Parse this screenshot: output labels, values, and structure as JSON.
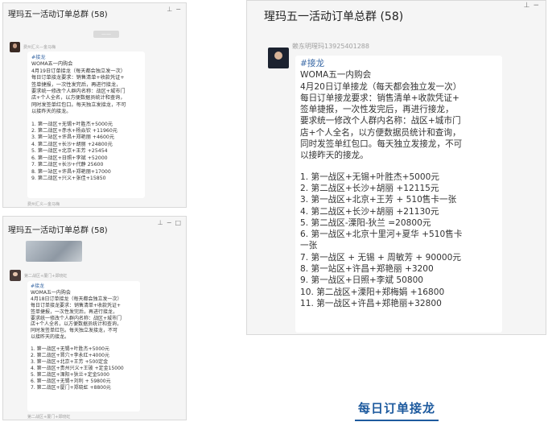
{
  "screens": [
    {
      "title": "瑆玛五一活动订单总群 (58)",
      "top_sender": "费州汇义—金马嗨",
      "timestamp": "——",
      "sender": "费州汇义—金马嗨",
      "tag": "#接龙",
      "lines": [
        "WOMA五一内购会",
        "4月19日订单接龙（每天都会独立发一次）",
        "每日订单接龙要求：销售清单+收款凭证+",
        "签单捷报，一次性发完后，再进行接龙，",
        "要求统一修改个人群内名称：战区+城市门",
        "店+个人全名，以方便数据员统计和查询，",
        "同时发签单红包口。每天独立发接龙，不可",
        "以接昨天的接龙。"
      ],
      "orders": [
        "1. 第一战区+无锡+叶胜杰+5000元",
        "2. 第二战区+赤水+杨焱钦 +11960元",
        "3. 第一站区+许昌+郑艳丽 +4600元",
        "4. 第二战区+长沙+胡丽 +24800元",
        "5. 第一战区+北京+王芳 +25454",
        "6. 第一战区+日照+李斌 +52000",
        "7. 第二战区+长沙+代静 25600",
        "8. 第一站区+许昌+郑艳丽+17000",
        "9. 第二战区+兴义+张佳+15850"
      ],
      "bottom_sender": "费州汇义—金马嗨"
    },
    {
      "title": "瑆玛五一活动订单总群 (58)",
      "sender": "第二战区+厦门+郑晓虹",
      "tag": "#接龙",
      "lines": [
        "WOMA五一内购会",
        "4月18日订单接龙（每天都会独立发一次）",
        "每日订单接龙要求：销售清单+收款凭证+",
        "签单捷报，一次性发完后，再进行接龙，",
        "要求统一修改个人群内名称：战区+城市门",
        "店+个人全名，以方便数据员统计和查询，",
        "同时发签单红包。每天独立发接龙，不可",
        "以接昨天的接龙。"
      ],
      "orders": [
        "1. 第一战区+无锡+叶胜杰+5000元",
        "2. 第二战区+晋穴+李永红+4000元",
        "3. 第一战区+北京+王芳 +500定金",
        "4. 第一战区+贵州兴义+王玻 +定金15000",
        "5. 第二战区+溧阳+狄兰+定金5000",
        "6. 第一战区+无锡+刘利 + 59800元",
        "7. 第二战区+厦门+郑晓虹 +8800元"
      ],
      "bottom_sender": "第二战区+厦门+郑晓虹"
    },
    {
      "title": "瑆玛五一活动订单总群 (58)",
      "sender": "赖东明瑆玛13925401288",
      "tag": "#接龙",
      "lines": [
        "WOMA五一内购会",
        "4月20日订单接龙（每天都会独立发一次）",
        "每日订单接龙要求：销售清单+收款凭证+",
        "签单捷报，一次性发完后，再进行接龙，",
        "要求统一修改个人群内名称：战区+城市门",
        "店+个人全名，以方便数据员统计和查询，",
        "同时发签单红包口。每天独立发接龙，不可",
        "以接昨天的接龙。"
      ],
      "orders": [
        "1. 第一战区+无锡+叶胜杰+5000元",
        "2. 第二战区+长沙+胡丽 +12115元",
        "3. 第一战区+北京+王芳 + 510售卡一张",
        "4. 第二战区+长沙+胡丽 +21130元",
        "5. 第二战区-溧阳-狄兰 =20800元",
        "6. 第一战区+北京十里河+夏华 +510售卡",
        "一张",
        "7. 第一战区 + 无锡 + 周敏芳 + 90000元",
        "8. 第一站区+许昌+郑艳丽 +3200",
        "9. 第一战区+日照+李斌 50800",
        "10. 第二战区+溧阳+郑梅娟 +16800",
        "11. 第一战区+许昌+郑艳丽+32800"
      ]
    }
  ],
  "caption": "每日订单接龙",
  "colors": {
    "caption": "#1d5a9e",
    "tag": "#3b6aa6",
    "panel_bg": "#f5f5f5"
  },
  "icons": {
    "pin": "pin-icon",
    "minimize": "minimize-icon",
    "maximize": "maximize-icon",
    "close": "close-icon"
  }
}
